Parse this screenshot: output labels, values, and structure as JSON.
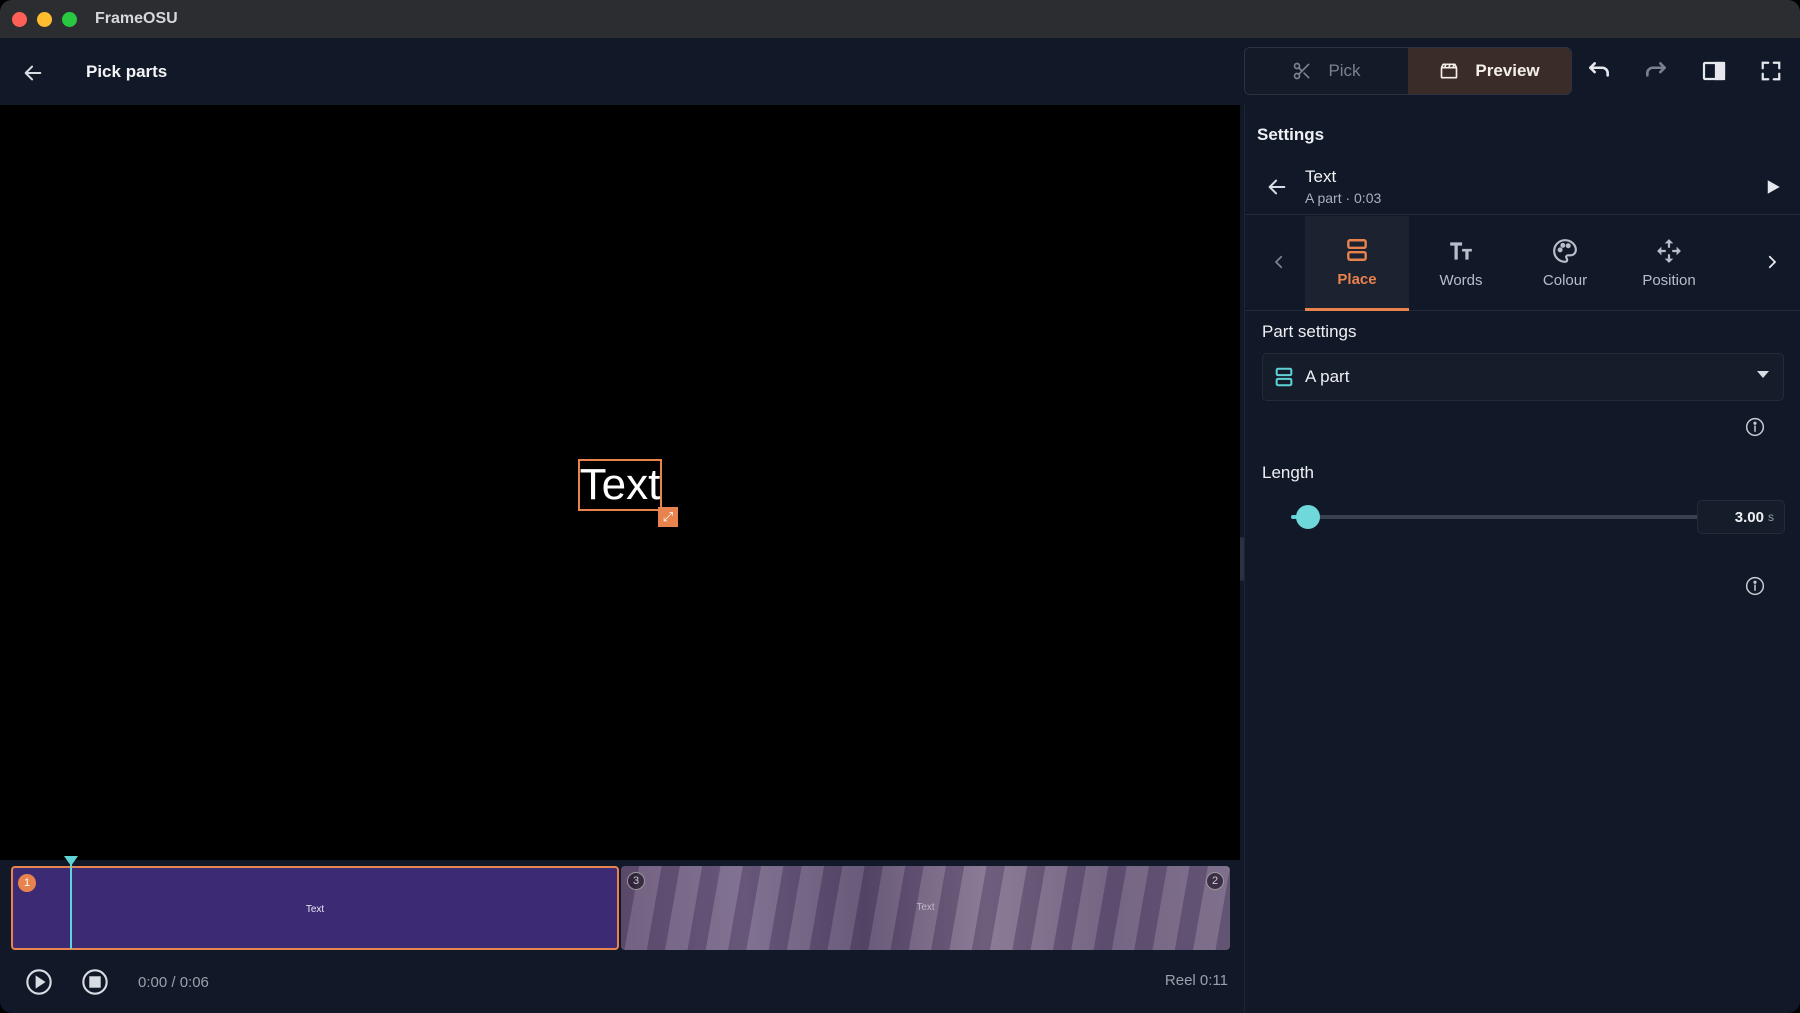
{
  "window": {
    "app_title": "FrameOSU"
  },
  "header": {
    "page_title": "Pick parts",
    "modes": {
      "pick_label": "Pick",
      "preview_label": "Preview"
    }
  },
  "canvas": {
    "text_element": "Text"
  },
  "timeline": {
    "clips": [
      {
        "number": "1",
        "label": "Text"
      },
      {
        "number_left": "3",
        "number_right": "2",
        "label": "Text"
      }
    ],
    "playhead_fraction": 0.1,
    "time_display": "0:00 / 0:06",
    "reel_label": "Reel 0:11"
  },
  "settings": {
    "title": "Settings",
    "item": {
      "name": "Text",
      "subtitle": "A part · 0:03"
    },
    "tabs": [
      {
        "label": "Place",
        "active": true
      },
      {
        "label": "Words",
        "active": false
      },
      {
        "label": "Colour",
        "active": false
      },
      {
        "label": "Position",
        "active": false
      }
    ],
    "part_settings": {
      "label": "Part settings",
      "selected": "A part"
    },
    "length": {
      "label": "Length",
      "value": "3.00",
      "unit": "s",
      "slider_fraction": 0.04
    }
  },
  "colors": {
    "accent": "#e8834e",
    "teal": "#5fd3d6",
    "clip_purple": "#3d2a74"
  }
}
